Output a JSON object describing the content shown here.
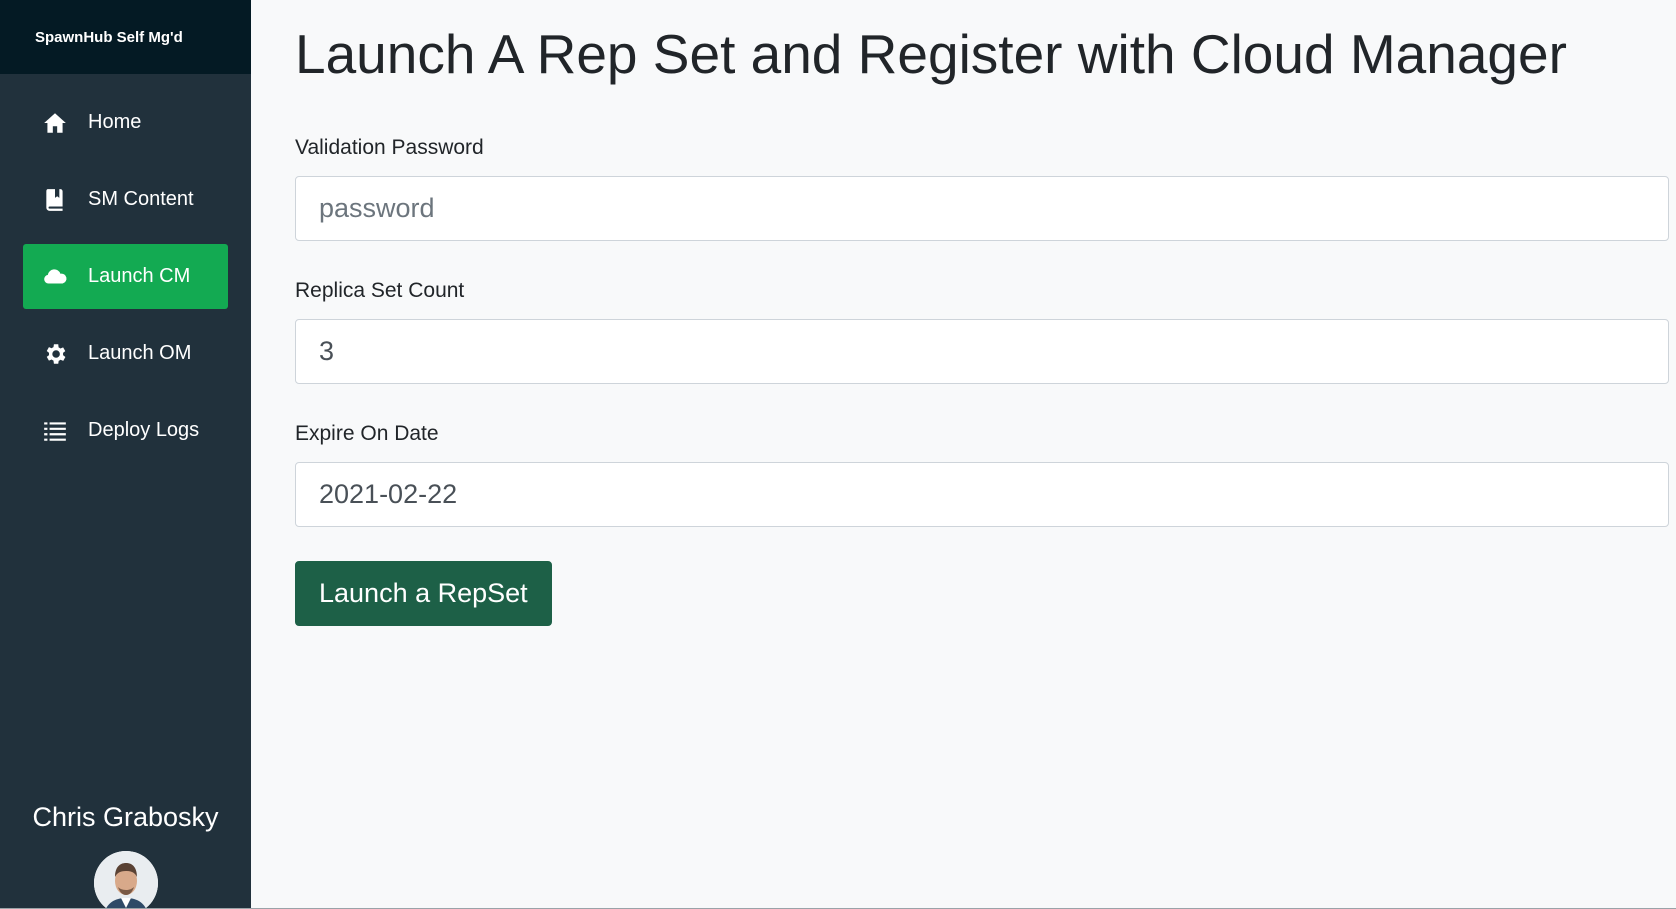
{
  "sidebar": {
    "brand": "SpawnHub Self Mg'd",
    "items": [
      {
        "label": "Home",
        "icon": "home-icon",
        "active": false
      },
      {
        "label": "SM Content",
        "icon": "book-icon",
        "active": false
      },
      {
        "label": "Launch CM",
        "icon": "cloud-icon",
        "active": true
      },
      {
        "label": "Launch OM",
        "icon": "gear-icon",
        "active": false
      },
      {
        "label": "Deploy Logs",
        "icon": "list-icon",
        "active": false
      }
    ],
    "profile": {
      "name": "Chris Grabosky"
    }
  },
  "main": {
    "title": "Launch A Rep Set and Register with Cloud Manager",
    "fields": {
      "password": {
        "label": "Validation Password",
        "placeholder": "password",
        "value": ""
      },
      "replica_count": {
        "label": "Replica Set Count",
        "value": "3"
      },
      "expire_date": {
        "label": "Expire On Date",
        "value": "2021-02-22"
      }
    },
    "submit_label": "Launch a RepSet"
  },
  "colors": {
    "sidebar_bg": "#21313c",
    "brand_bg": "#041a24",
    "active_item": "#13aa52",
    "button_bg": "#1d6047",
    "main_bg": "#f8f9fa"
  }
}
